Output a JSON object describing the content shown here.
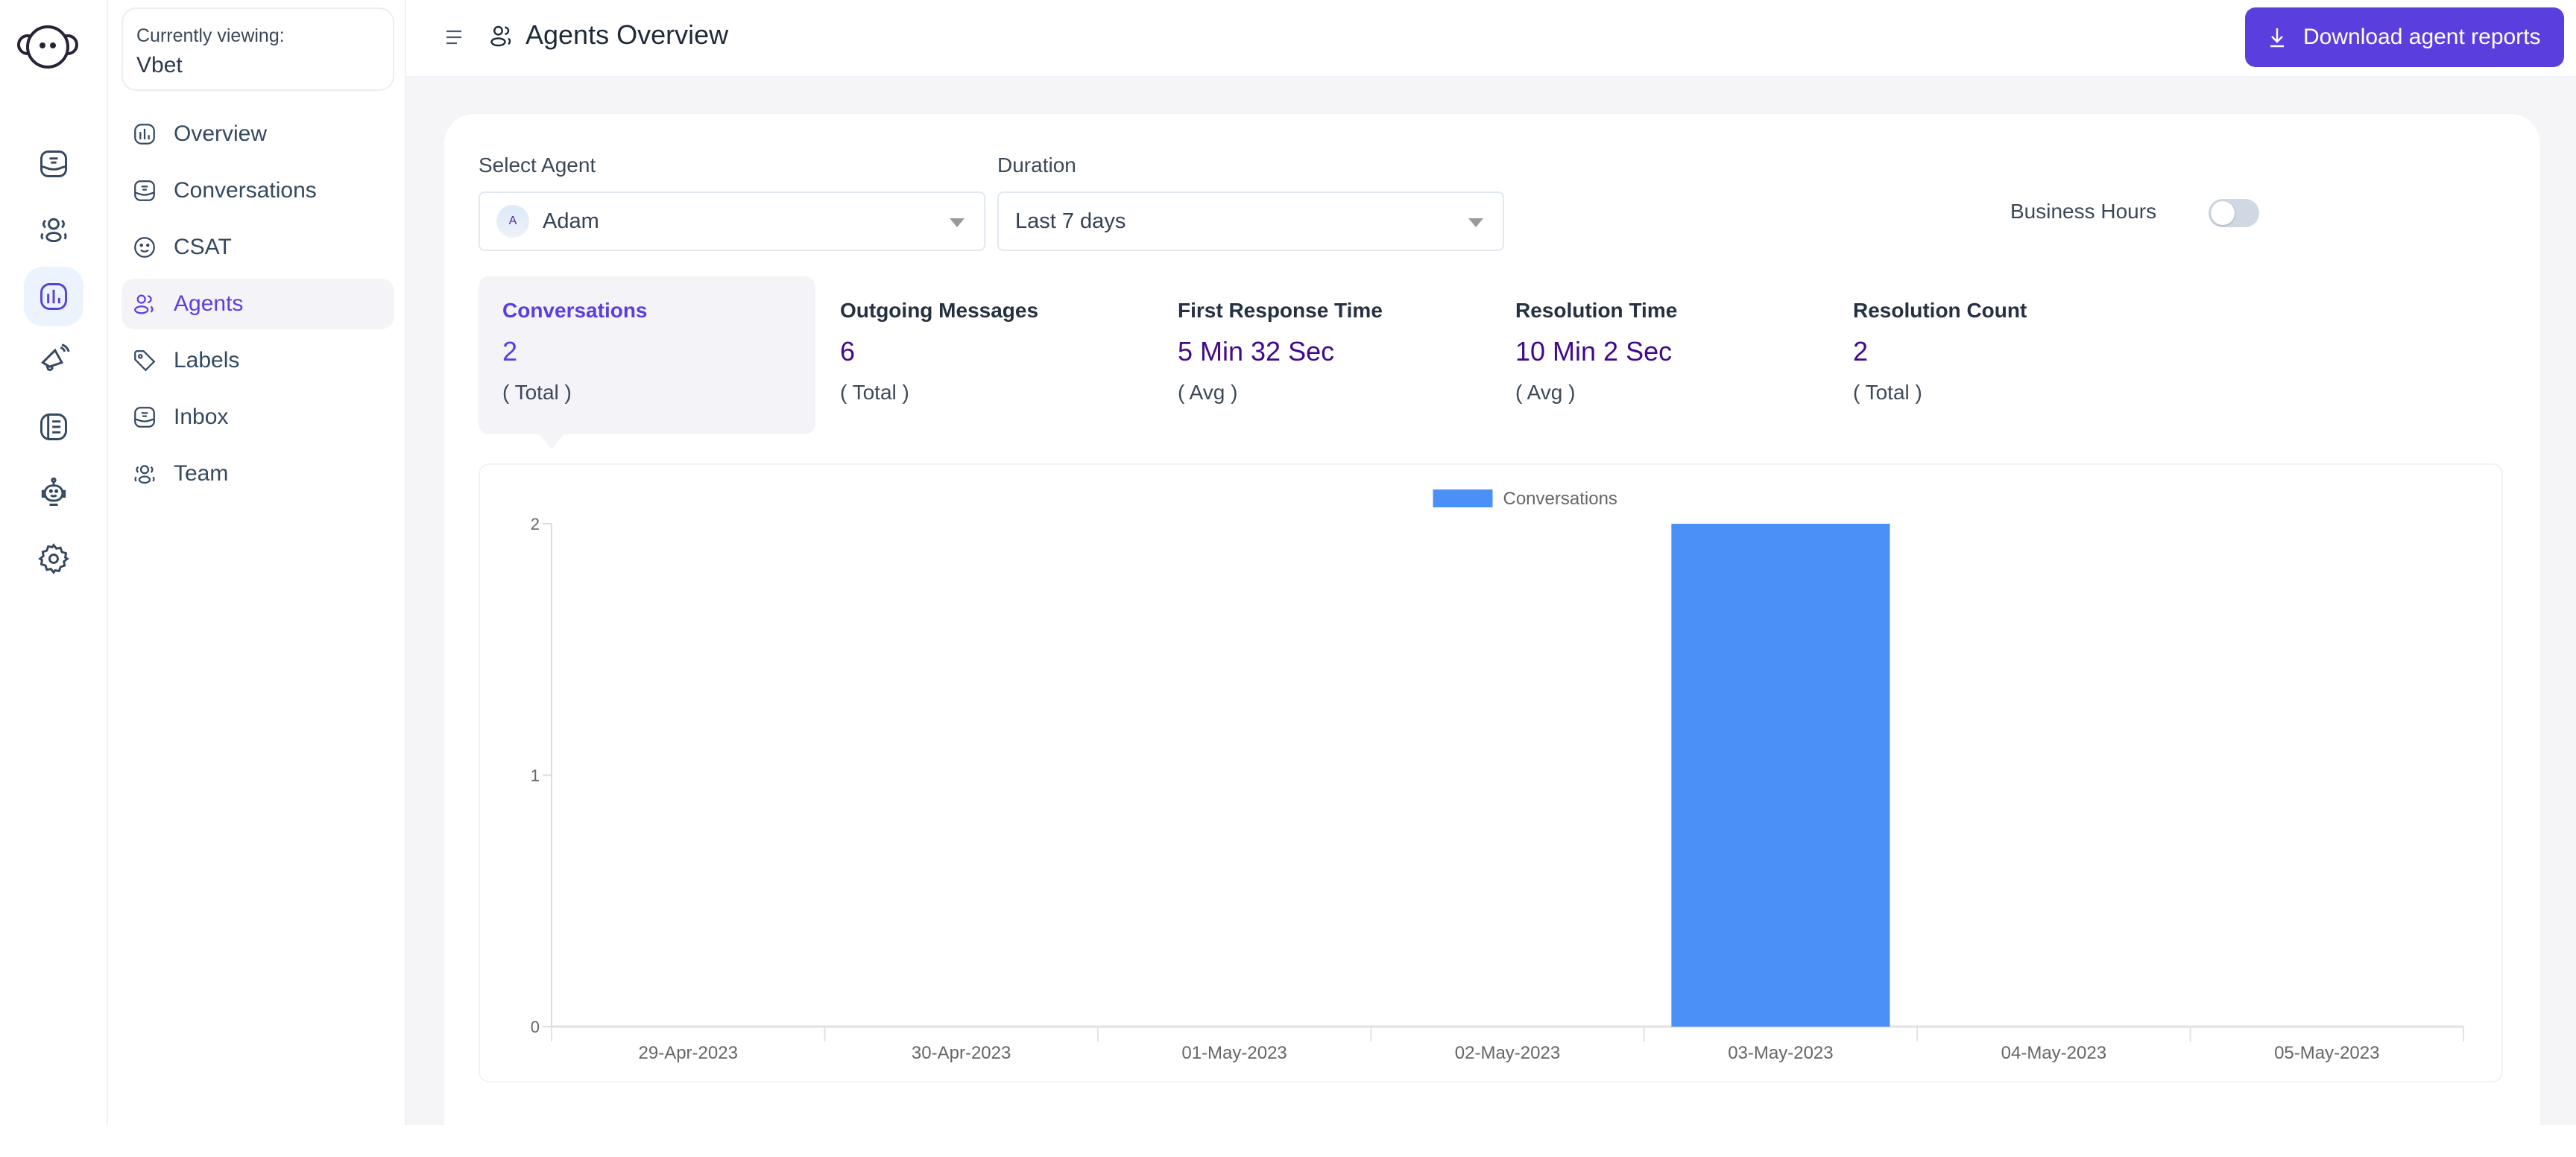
{
  "app": {
    "brand_icon": "chatwoot-logo-icon"
  },
  "rail": {
    "items": [
      {
        "name": "conversations",
        "icon": "inbox-icon",
        "active": false
      },
      {
        "name": "contacts",
        "icon": "contacts-icon",
        "active": false
      },
      {
        "name": "reports",
        "icon": "reports-chart-icon",
        "active": true
      },
      {
        "name": "campaigns",
        "icon": "megaphone-icon",
        "active": false
      },
      {
        "name": "help-center",
        "icon": "book-icon",
        "active": false
      },
      {
        "name": "bots",
        "icon": "bot-icon",
        "active": false
      },
      {
        "name": "settings",
        "icon": "gear-icon",
        "active": false
      }
    ]
  },
  "subnav": {
    "viewing_label": "Currently viewing:",
    "viewing_value": "Vbet",
    "items": [
      {
        "label": "Overview",
        "icon": "chart-icon",
        "active": false
      },
      {
        "label": "Conversations",
        "icon": "inbox-icon",
        "active": false
      },
      {
        "label": "CSAT",
        "icon": "smile-icon",
        "active": false
      },
      {
        "label": "Agents",
        "icon": "agents-icon",
        "active": true
      },
      {
        "label": "Labels",
        "icon": "tag-icon",
        "active": false
      },
      {
        "label": "Inbox",
        "icon": "inbox-icon",
        "active": false
      },
      {
        "label": "Team",
        "icon": "team-icon",
        "active": false
      }
    ]
  },
  "header": {
    "title": "Agents Overview",
    "download_label": "Download agent reports"
  },
  "filters": {
    "agent_label": "Select Agent",
    "agent_value": "Adam",
    "agent_initial": "A",
    "duration_label": "Duration",
    "duration_value": "Last 7 days",
    "business_hours_label": "Business Hours",
    "business_hours_on": false
  },
  "metrics": [
    {
      "title": "Conversations",
      "value": "2",
      "sub": "( Total )",
      "active": true
    },
    {
      "title": "Outgoing Messages",
      "value": "6",
      "sub": "( Total )",
      "active": false
    },
    {
      "title": "First Response Time",
      "value": "5 Min 32 Sec",
      "sub": "( Avg )",
      "active": false
    },
    {
      "title": "Resolution Time",
      "value": "10 Min 2 Sec",
      "sub": "( Avg )",
      "active": false
    },
    {
      "title": "Resolution Count",
      "value": "2",
      "sub": "( Total )",
      "active": false
    }
  ],
  "colors": {
    "accent": "#5b3fde",
    "bar": "#4a90f7",
    "metric_value": "#42098a"
  },
  "chart_data": {
    "type": "bar",
    "title": "",
    "xlabel": "",
    "ylabel": "",
    "categories": [
      "29-Apr-2023",
      "30-Apr-2023",
      "01-May-2023",
      "02-May-2023",
      "03-May-2023",
      "04-May-2023",
      "05-May-2023"
    ],
    "series": [
      {
        "name": "Conversations",
        "values": [
          0,
          0,
          0,
          0,
          2,
          0,
          0
        ]
      }
    ],
    "ylim": [
      0,
      2
    ],
    "yticks": [
      0,
      1,
      2
    ],
    "grid": false,
    "legend": "top-center"
  }
}
